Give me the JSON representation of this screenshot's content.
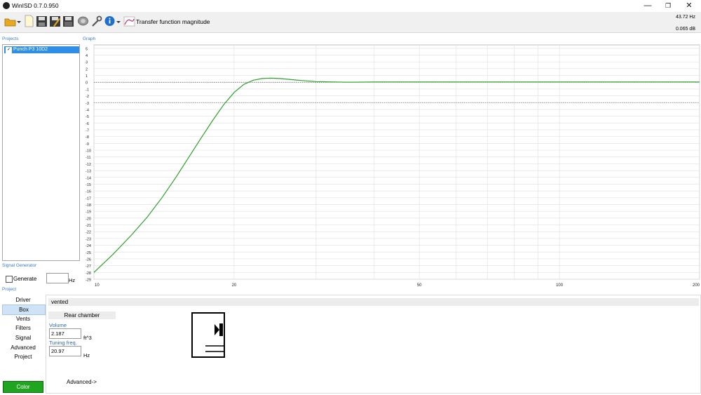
{
  "window": {
    "title": "WinISD 0.7.0.950",
    "minimize_glyph": "—",
    "restore_glyph": "❐",
    "close_glyph": "✕"
  },
  "toolbar": {
    "title": "Transfer function magnitude",
    "readout_freq": "43.72 Hz",
    "readout_db": "0.065 dB",
    "icons": [
      "open-folder-icon",
      "new-document-icon",
      "save-icon",
      "save-as-icon",
      "save-all-icon",
      "driver-icon",
      "wrench-icon",
      "info-icon",
      "transfer-function-icon"
    ]
  },
  "sections": {
    "projects": "Projects",
    "graph": "Graph",
    "signal_generator": "Signal Generator",
    "project": "Project"
  },
  "projects": {
    "items": [
      {
        "label": "Punch P3 10D2",
        "checked": true
      }
    ]
  },
  "signal": {
    "generate_label": "Generate",
    "hz_value": "",
    "hz_unit": "Hz"
  },
  "nav": {
    "items": [
      "Driver",
      "Box",
      "Vents",
      "Filters",
      "Signal",
      "Advanced",
      "Project"
    ],
    "selected": "Box",
    "color_label": "Color",
    "color_swatch": "#1fa51f"
  },
  "box": {
    "type": "vented",
    "chamber_label": "Rear chamber",
    "volume_label": "Volume",
    "volume_value": "2.187",
    "volume_unit": "ft^3",
    "tuning_label": "Tuning freq.",
    "tuning_value": "20.97",
    "tuning_unit": "Hz",
    "advanced_label": "Advanced->"
  },
  "chart_data": {
    "type": "line",
    "title": "",
    "xlabel": "",
    "ylabel": "",
    "x_scale": "log",
    "xlim": [
      10,
      200
    ],
    "ylim": [
      -29,
      5.5
    ],
    "x_ticks": [
      10,
      20,
      50,
      100,
      200
    ],
    "y_ticks": [
      5,
      4,
      3,
      2,
      1,
      0,
      -1,
      -2,
      -3,
      -4,
      -5,
      -6,
      -7,
      -8,
      -9,
      -10,
      -11,
      -12,
      -13,
      -14,
      -15,
      -16,
      -17,
      -18,
      -19,
      -20,
      -21,
      -22,
      -23,
      -24,
      -25,
      -26,
      -27,
      -28,
      -29
    ],
    "reference_lines": [
      0,
      -3
    ],
    "grid": true,
    "series": [
      {
        "color": "#2ea02e",
        "x": [
          10,
          11,
          12,
          13,
          14,
          15,
          16,
          17,
          18,
          19,
          20,
          21,
          22,
          23,
          24,
          25,
          26,
          27,
          28,
          30,
          35,
          40,
          50,
          60,
          80,
          100,
          150,
          200
        ],
        "y": [
          -28,
          -25.3,
          -22.6,
          -19.9,
          -17.0,
          -14.0,
          -11.0,
          -8.2,
          -5.6,
          -3.3,
          -1.5,
          -0.3,
          0.3,
          0.55,
          0.6,
          0.55,
          0.45,
          0.35,
          0.25,
          0.1,
          0.0,
          0.05,
          0.05,
          0.05,
          0.05,
          0.05,
          0.05,
          0.05
        ]
      }
    ]
  }
}
